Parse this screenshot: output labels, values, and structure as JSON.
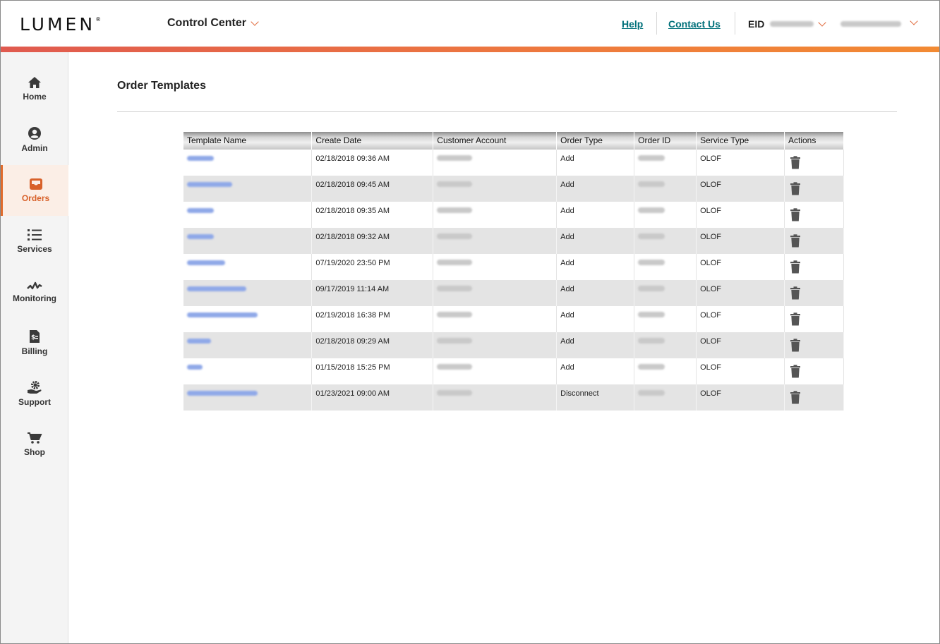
{
  "header": {
    "logo": "LUMEN",
    "logo_mark": "®",
    "app_menu": "Control Center",
    "help": "Help",
    "contact": "Contact Us",
    "eid_label": "EID"
  },
  "sidebar": {
    "items": [
      {
        "label": "Home",
        "icon": "home-icon"
      },
      {
        "label": "Admin",
        "icon": "user-circle-icon"
      },
      {
        "label": "Orders",
        "icon": "inbox-icon"
      },
      {
        "label": "Services",
        "icon": "list-icon"
      },
      {
        "label": "Monitoring",
        "icon": "pulse-icon"
      },
      {
        "label": "Billing",
        "icon": "invoice-icon"
      },
      {
        "label": "Support",
        "icon": "gear-hand-icon"
      },
      {
        "label": "Shop",
        "icon": "cart-icon"
      }
    ],
    "active": "Orders"
  },
  "page": {
    "title": "Order Templates"
  },
  "table": {
    "columns": [
      "Template Name",
      "Create Date",
      "Customer Account",
      "Order Type",
      "Order ID",
      "Service Type",
      "Actions"
    ],
    "rows": [
      {
        "create_date": "02/18/2018 09:36 AM",
        "order_type": "Add",
        "service_type": "OLOF"
      },
      {
        "create_date": "02/18/2018 09:45 AM",
        "order_type": "Add",
        "service_type": "OLOF"
      },
      {
        "create_date": "02/18/2018 09:35 AM",
        "order_type": "Add",
        "service_type": "OLOF"
      },
      {
        "create_date": "02/18/2018 09:32 AM",
        "order_type": "Add",
        "service_type": "OLOF"
      },
      {
        "create_date": "07/19/2020 23:50 PM",
        "order_type": "Add",
        "service_type": "OLOF"
      },
      {
        "create_date": "09/17/2019 11:14 AM",
        "order_type": "Add",
        "service_type": "OLOF"
      },
      {
        "create_date": "02/19/2018 16:38 PM",
        "order_type": "Add",
        "service_type": "OLOF"
      },
      {
        "create_date": "02/18/2018 09:29 AM",
        "order_type": "Add",
        "service_type": "OLOF"
      },
      {
        "create_date": "01/15/2018 15:25 PM",
        "order_type": "Add",
        "service_type": "OLOF"
      },
      {
        "create_date": "01/23/2021 09:00 AM",
        "order_type": "Disconnect",
        "service_type": "OLOF"
      }
    ]
  },
  "colors": {
    "accent": "#e06b2c",
    "link": "#00707a",
    "gradient_start": "#e05a4f",
    "gradient_end": "#f28a33"
  }
}
